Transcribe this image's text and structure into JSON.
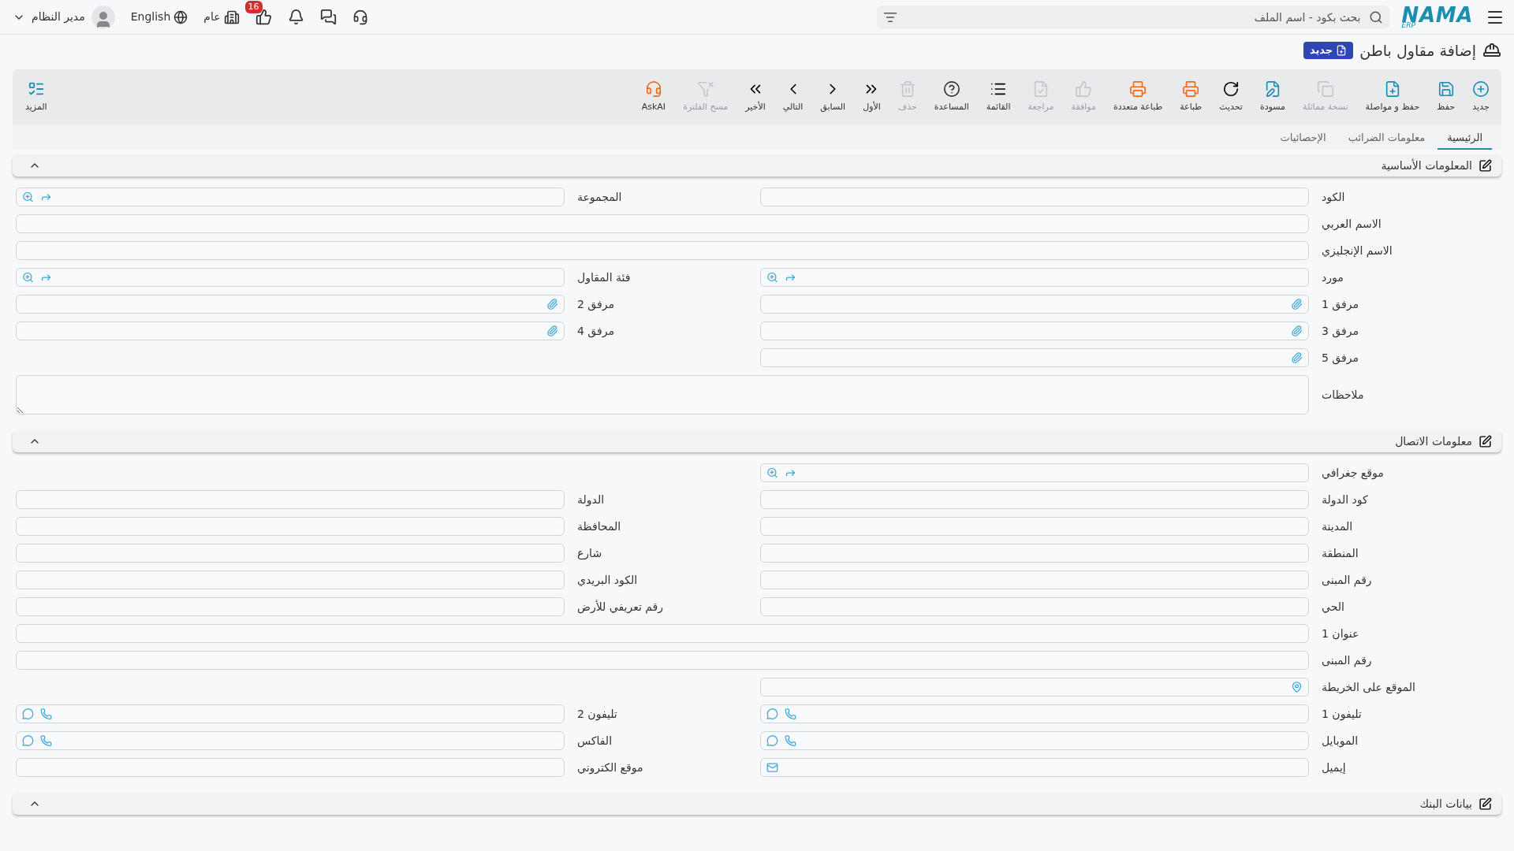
{
  "top_bar": {
    "logo": {
      "main": "NAMA",
      "sub": "ERP"
    },
    "search": {
      "placeholder": "بحث بكود - اسم الملف"
    },
    "branch": "عام",
    "notifications_badge": "16",
    "language": "English",
    "user": "مدير النظام"
  },
  "page": {
    "title": "إضافة مقاول باطن",
    "badge": "جديد"
  },
  "toolbar": [
    {
      "kind": "new",
      "label": "جديد",
      "disabled": false
    },
    {
      "kind": "save",
      "label": "حفظ",
      "disabled": false
    },
    {
      "kind": "save_continue",
      "label": "حفظ و مواصلة",
      "disabled": false
    },
    {
      "kind": "duplicate",
      "label": "نسخة مماثلة",
      "disabled": true
    },
    {
      "kind": "draft",
      "label": "مسودة",
      "disabled": false
    },
    {
      "kind": "refresh",
      "label": "تحديث",
      "disabled": false
    },
    {
      "kind": "print",
      "label": "طباعة",
      "disabled": false
    },
    {
      "kind": "multi_print",
      "label": "طباعة متعددة",
      "disabled": false
    },
    {
      "kind": "approve",
      "label": "موافقة",
      "disabled": true
    },
    {
      "kind": "review",
      "label": "مراجعة",
      "disabled": true
    },
    {
      "kind": "list",
      "label": "القائمة",
      "disabled": false
    },
    {
      "kind": "help",
      "label": "المساعدة",
      "disabled": false
    },
    {
      "kind": "delete",
      "label": "حذف",
      "disabled": true
    },
    {
      "kind": "first",
      "label": "الأول",
      "disabled": false
    },
    {
      "kind": "previous",
      "label": "السابق",
      "disabled": false
    },
    {
      "kind": "next",
      "label": "التالي",
      "disabled": false
    },
    {
      "kind": "last",
      "label": "الأخير",
      "disabled": false
    },
    {
      "kind": "clear_filter",
      "label": "مسح الفلترة",
      "disabled": true
    },
    {
      "kind": "ask_ai",
      "label": "AskAI",
      "disabled": false
    }
  ],
  "more_button": "المزيد",
  "tabs": [
    {
      "label": "الرئيسية",
      "selected": true
    },
    {
      "label": "معلومات الضرائب",
      "selected": false
    },
    {
      "label": "الإحصائيات",
      "selected": false
    }
  ],
  "sections": [
    {
      "title": "المعلومات الأساسية",
      "expanded": true,
      "rows": [
        [
          {
            "label": "الكود",
            "kind": "text"
          },
          {
            "label": "المجموعة",
            "kind": "lookup"
          }
        ],
        [
          {
            "label": "الاسم العربي",
            "kind": "wide"
          }
        ],
        [
          {
            "label": "الاسم الإنجليزي",
            "kind": "wide"
          }
        ],
        [
          {
            "label": "مورد",
            "kind": "lookup"
          },
          {
            "label": "فئة المقاول",
            "kind": "lookup"
          }
        ],
        [
          {
            "label": "مرفق 1",
            "kind": "attachment"
          },
          {
            "label": "مرفق 2",
            "kind": "attachment"
          }
        ],
        [
          {
            "label": "مرفق 3",
            "kind": "attachment"
          },
          {
            "label": "مرفق 4",
            "kind": "attachment"
          }
        ],
        [
          {
            "label": "مرفق 5",
            "kind": "attachment"
          }
        ],
        [
          {
            "label": "ملاحظات",
            "kind": "notes"
          }
        ]
      ]
    },
    {
      "title": "معلومات الاتصال",
      "expanded": true,
      "rows": [
        [
          {
            "label": "موقع جغرافي",
            "kind": "lookup"
          }
        ],
        [
          {
            "label": "كود الدولة",
            "kind": "text"
          },
          {
            "label": "الدولة",
            "kind": "text"
          }
        ],
        [
          {
            "label": "المدينة",
            "kind": "text"
          },
          {
            "label": "المحافظة",
            "kind": "text"
          }
        ],
        [
          {
            "label": "المنطقة",
            "kind": "text"
          },
          {
            "label": "شارع",
            "kind": "text"
          }
        ],
        [
          {
            "label": "رقم المبنى",
            "kind": "text"
          },
          {
            "label": "الكود البريدي",
            "kind": "text"
          }
        ],
        [
          {
            "label": "الحي",
            "kind": "text"
          },
          {
            "label": "رقم تعريفي للأرض",
            "kind": "text"
          }
        ],
        [
          {
            "label": "عنوان 1",
            "kind": "wide"
          }
        ],
        [
          {
            "label": "رقم المبنى",
            "kind": "wide"
          }
        ],
        [
          {
            "label": "الموقع على الخريطة",
            "kind": "map"
          }
        ],
        [
          {
            "label": "تليفون 1",
            "kind": "phone"
          },
          {
            "label": "تليفون 2",
            "kind": "phone"
          }
        ],
        [
          {
            "label": "الموبايل",
            "kind": "phone"
          },
          {
            "label": "الفاكس",
            "kind": "phone"
          }
        ],
        [
          {
            "label": "إيميل",
            "kind": "email"
          },
          {
            "label": "موقع الكتروني",
            "kind": "text"
          }
        ]
      ]
    },
    {
      "title": "بيانات البنك",
      "expanded": true
    }
  ]
}
